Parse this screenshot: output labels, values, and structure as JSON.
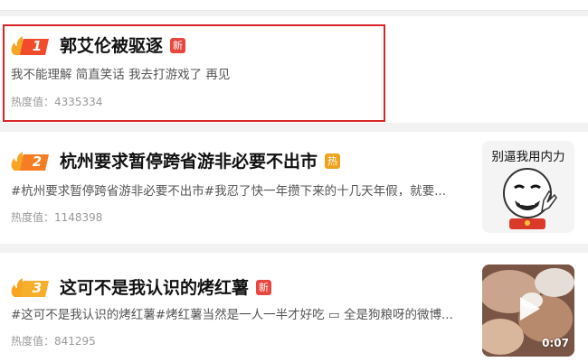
{
  "items": [
    {
      "rank": "1",
      "title": "郭艾伦被驱逐",
      "tag": "新",
      "desc": "我不能理解 简直笑话 我去打游戏了 再见",
      "heat": "热度值：4335334"
    },
    {
      "rank": "2",
      "title": "杭州要求暂停跨省游非必要不出市",
      "tag": "热",
      "desc": "#杭州要求暂停跨省游非必要不出市#我忍了快一年攒下来的十几天年假，就要...",
      "heat": "热度值：1148398",
      "thumb_caption": "别逼我用内力"
    },
    {
      "rank": "3",
      "title": "这可不是我认识的烤红薯",
      "tag": "新",
      "desc": "#这可不是我认识的烤红薯#烤红薯当然是一人一半才好吃 ▭ 全是狗粮呀的微博...",
      "heat": "热度值：841295",
      "video_duration": "0:07"
    }
  ],
  "colors": {
    "rank1": "#f14b2c",
    "rank2": "#f77d23",
    "rank3": "#f7ae2a",
    "highlight": "#d9252a",
    "tag_new": "#e8473f",
    "tag_hot": "#f0a21d"
  },
  "icons": {
    "rank_badge": "flame-rank-icon",
    "tag_new": "new-tag-icon",
    "tag_hot": "hot-tag-icon",
    "video_play": "play-icon"
  }
}
